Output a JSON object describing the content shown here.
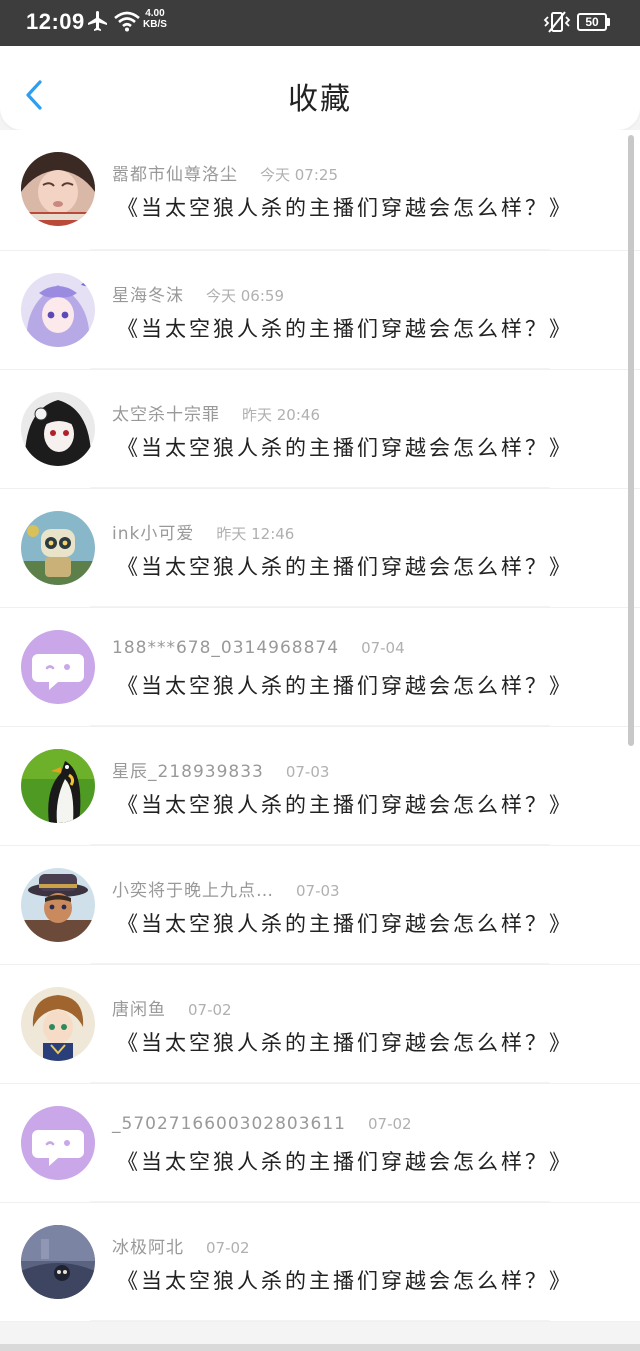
{
  "status_bar": {
    "time": "12:09",
    "speed_value": "4.00",
    "speed_unit": "KB/S",
    "battery": "50"
  },
  "header": {
    "title": "收藏"
  },
  "items": [
    {
      "name": "嚣都市仙尊洛尘",
      "time": "今天 07:25",
      "content": "《当太空狼人杀的主播们穿越会怎么样？》",
      "avatar": "photo-girl"
    },
    {
      "name": "星海冬沫",
      "time": "今天 06:59",
      "content": "《当太空狼人杀的主播们穿越会怎么样？》",
      "avatar": "anime-lilac"
    },
    {
      "name": "太空杀十宗罪",
      "time": "昨天 20:46",
      "content": "《当太空狼人杀的主播们穿越会怎么样？》",
      "avatar": "anime-dark"
    },
    {
      "name": "ink小可爱",
      "time": "昨天 12:46",
      "content": "《当太空狼人杀的主播们穿越会怎么样？》",
      "avatar": "anime-robot"
    },
    {
      "name": "188***678_0314968874",
      "time": "07-04",
      "content": "《当太空狼人杀的主播们穿越会怎么样？》",
      "avatar": "default-chat"
    },
    {
      "name": "星辰_218939833",
      "time": "07-03",
      "content": "《当太空狼人杀的主播们穿越会怎么样？》",
      "avatar": "penguin"
    },
    {
      "name": "小奕将于晚上九点…",
      "time": "07-03",
      "content": "《当太空狼人杀的主播们穿越会怎么样？》",
      "avatar": "anime-hat"
    },
    {
      "name": "唐闲鱼",
      "time": "07-02",
      "content": "《当太空狼人杀的主播们穿越会怎么样？》",
      "avatar": "anime-boy"
    },
    {
      "name": "_5702716600302803611",
      "time": "07-02",
      "content": "《当太空狼人杀的主播们穿越会怎么样？》",
      "avatar": "default-chat"
    },
    {
      "name": "冰极阿北",
      "time": "07-02",
      "content": "《当太空狼人杀的主播们穿越会怎么样？》",
      "avatar": "dark-scene"
    }
  ],
  "colors": {
    "accent": "#2d9ef0",
    "status_bar_bg": "#3d3d3d",
    "default_avatar_bg": "#c9a7e8"
  }
}
